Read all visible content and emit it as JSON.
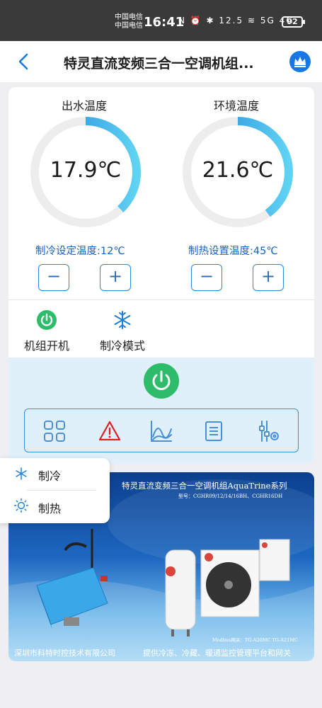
{
  "status_bar": {
    "carrier1": "中国电信",
    "carrier2": "中国电信",
    "time": "16:41",
    "icons": "N ⏰ ✱ 12.5 ≋ 5G 4G",
    "battery": "92"
  },
  "header": {
    "title": "特灵直流变频三合一空调机组...",
    "back_icon": "chevron-left-icon",
    "crown_icon": "crown-icon",
    "accent": "#1677e5"
  },
  "gauges": [
    {
      "label": "出水温度",
      "value": "17.9℃",
      "level": 0.38
    },
    {
      "label": "环境温度",
      "value": "21.6℃",
      "level": 0.4
    }
  ],
  "setpoints": [
    {
      "label": "制冷设定温度:12℃",
      "minus": "−",
      "plus": "+"
    },
    {
      "label": "制热设置温度:45℃",
      "minus": "−",
      "plus": "+"
    }
  ],
  "modes": {
    "unit_power": {
      "label": "机组开机",
      "icon": "power-icon",
      "color": "#2dbd6a"
    },
    "mode": {
      "label": "制冷模式",
      "icon": "snowflake-icon",
      "color": "#1e7fd6"
    }
  },
  "toolbar": {
    "power_icon": "power-icon",
    "tools": [
      "grid-icon",
      "alarm-icon",
      "chart-icon",
      "list-icon",
      "settings-sliders-icon"
    ],
    "alarm_color": "#e02020"
  },
  "popup": {
    "items": [
      {
        "label": "制冷",
        "icon": "snowflake-icon"
      },
      {
        "label": "制热",
        "icon": "sun-icon"
      }
    ]
  },
  "banner": {
    "title": "特灵直流变频三合一空调机组AquaTrine系列",
    "model": "型号：CGHR09/12/14/16BH、CGHR16DH",
    "modbus": "Modbus网关：TG-A20MC TG-A21MC",
    "footer_left": "深圳市科特时控技术有限公司",
    "footer_right": "提供冷冻、冷藏、暖通监控管理平台和网关"
  }
}
